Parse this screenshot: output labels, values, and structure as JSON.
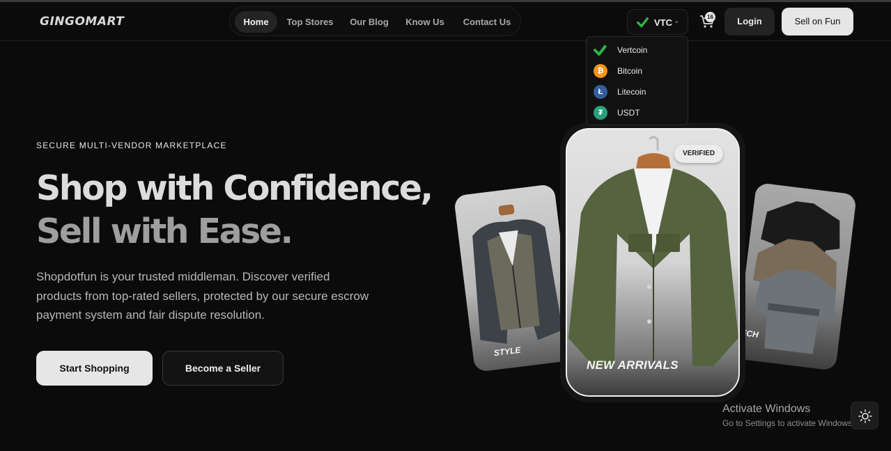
{
  "header": {
    "logo": "GINGOMART",
    "nav": [
      {
        "label": "Home",
        "active": true
      },
      {
        "label": "Top Stores",
        "active": false
      },
      {
        "label": "Our Blog",
        "active": false
      },
      {
        "label": "Know Us",
        "active": false
      },
      {
        "label": "Contact Us",
        "active": false
      }
    ],
    "currency": {
      "selected": "VTC",
      "icon": "check-badge-icon"
    },
    "cart": {
      "count": "16",
      "icon": "cart-icon"
    },
    "login_label": "Login",
    "sell_label": "Sell on Fun"
  },
  "currency_dropdown": [
    {
      "name": "Vertcoin",
      "icon": "vertcoin-icon",
      "color": "#1b1b1b",
      "glyph": "✓"
    },
    {
      "name": "Bitcoin",
      "icon": "bitcoin-icon",
      "color": "#f7931a",
      "glyph": "₿"
    },
    {
      "name": "Litecoin",
      "icon": "litecoin-icon",
      "color": "#345d9d",
      "glyph": "Ł"
    },
    {
      "name": "USDT",
      "icon": "tether-icon",
      "color": "#26a17b",
      "glyph": "₮"
    }
  ],
  "hero": {
    "eyebrow": "SECURE MULTI-VENDOR MARKETPLACE",
    "headline_line1": "Shop with Confidence,",
    "headline_line2": "Sell with Ease.",
    "description": "Shopdotfun is your trusted middleman. Discover verified products from top-rated sellers, protected by our secure escrow payment system and fair dispute resolution.",
    "primary_cta": "Start Shopping",
    "secondary_cta": "Become a Seller"
  },
  "showcase": {
    "left_label": "STYLE",
    "right_label": "ECH",
    "center_label": "NEW ARRIVALS",
    "badge": "VERIFIED"
  },
  "windows_watermark": {
    "title": "Activate Windows",
    "subtitle": "Go to Settings to activate Windows."
  },
  "theme_toggle_icon": "sun-icon",
  "colors": {
    "background": "#0b0b0b",
    "accent_light": "#e6e6e6",
    "vtc_green": "#2fb344"
  }
}
